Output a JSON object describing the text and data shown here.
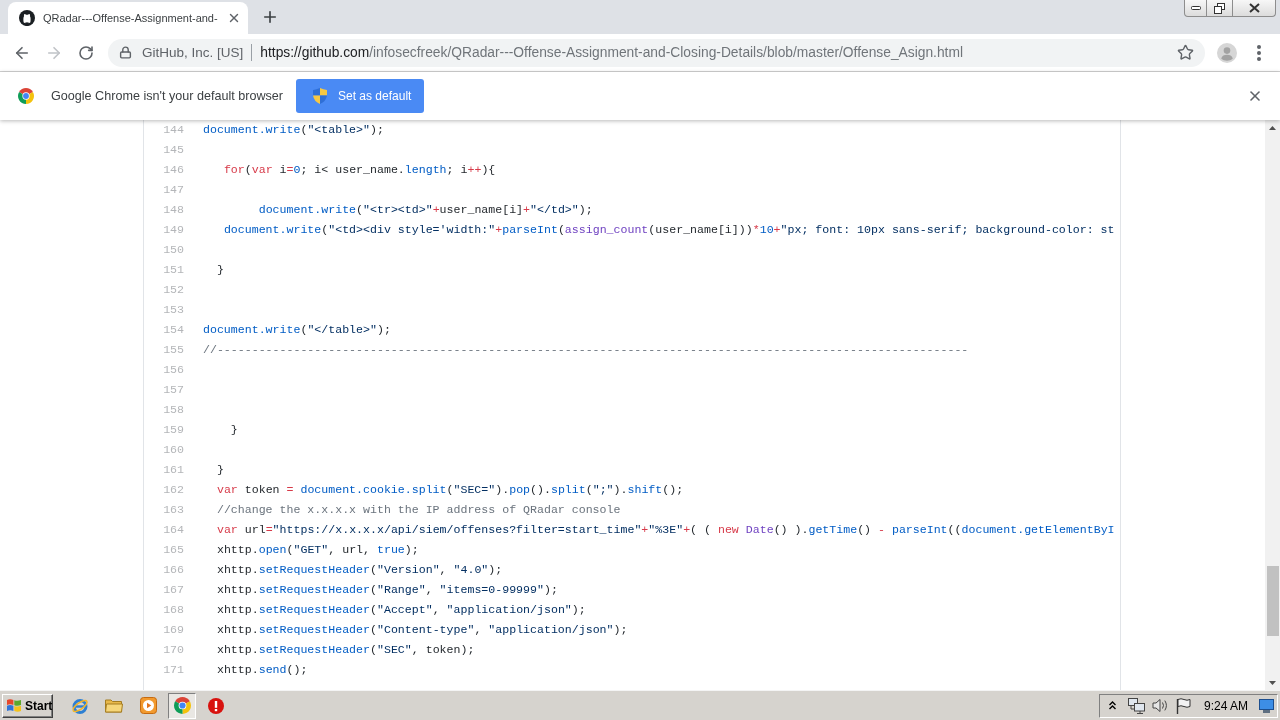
{
  "browser": {
    "tabs": [
      {
        "title": "QRadar---Offense-Assignment-and-",
        "selected": true
      }
    ],
    "navigation": [
      {
        "kind": "back",
        "disabled": false
      },
      {
        "kind": "forward",
        "disabled": true
      },
      {
        "kind": "reload",
        "disabled": false
      }
    ],
    "address_bar": {
      "site_identity": "GitHub, Inc. [US]",
      "url_origin": "https://github.com",
      "url_path": "/infosecfreek/QRadar---Offense-Assignment-and-Closing-Details/blob/master/Offense_Asign.html",
      "bookmarked": false
    }
  },
  "infobar": {
    "message": "Google Chrome isn't your default browser",
    "button": "Set as default"
  },
  "code": {
    "lines": [
      {
        "number": "144",
        "tokens": [
          {
            "kind": "builtin",
            "text": "document.write"
          },
          {
            "kind": "text",
            "text": "("
          },
          {
            "kind": "string",
            "text": "\"<table>\""
          },
          {
            "kind": "text",
            "text": ");"
          }
        ]
      },
      {
        "number": "145"
      },
      {
        "number": "146",
        "tokens": [
          {
            "kind": "keyword",
            "text": "   for"
          },
          {
            "kind": "text",
            "text": "("
          },
          {
            "kind": "keyword",
            "text": "var"
          },
          {
            "kind": "text",
            "text": " i"
          },
          {
            "kind": "keyword",
            "text": "="
          },
          {
            "kind": "builtin",
            "text": "0"
          },
          {
            "kind": "text",
            "text": "; i< user_name."
          },
          {
            "kind": "builtin",
            "text": "length"
          },
          {
            "kind": "text",
            "text": "; i"
          },
          {
            "kind": "keyword",
            "text": "++"
          },
          {
            "kind": "text",
            "text": "){"
          }
        ]
      },
      {
        "number": "147"
      },
      {
        "number": "148",
        "tokens": [
          {
            "kind": "builtin",
            "text": "        document.write"
          },
          {
            "kind": "text",
            "text": "("
          },
          {
            "kind": "string",
            "text": "\"<tr><td>\""
          },
          {
            "kind": "keyword",
            "text": "+"
          },
          {
            "kind": "text",
            "text": "user_name[i]"
          },
          {
            "kind": "keyword",
            "text": "+"
          },
          {
            "kind": "string",
            "text": "\"</td>\""
          },
          {
            "kind": "text",
            "text": ");"
          }
        ]
      },
      {
        "number": "149",
        "tokens": [
          {
            "kind": "builtin",
            "text": "   document.write"
          },
          {
            "kind": "text",
            "text": "("
          },
          {
            "kind": "string",
            "text": "\"<td><div style='width:\""
          },
          {
            "kind": "keyword",
            "text": "+"
          },
          {
            "kind": "builtin",
            "text": "parseInt"
          },
          {
            "kind": "text",
            "text": "("
          },
          {
            "kind": "function",
            "text": "assign_count"
          },
          {
            "kind": "text",
            "text": "(user_name[i]))"
          },
          {
            "kind": "keyword",
            "text": "*"
          },
          {
            "kind": "builtin",
            "text": "10"
          },
          {
            "kind": "keyword",
            "text": "+"
          },
          {
            "kind": "string",
            "text": "\"px; font: 10px sans-serif; background-color: st"
          }
        ]
      },
      {
        "number": "150"
      },
      {
        "number": "151",
        "tokens": [
          {
            "kind": "text",
            "text": "  }"
          }
        ]
      },
      {
        "number": "152"
      },
      {
        "number": "153"
      },
      {
        "number": "154",
        "tokens": [
          {
            "kind": "builtin",
            "text": "document.write"
          },
          {
            "kind": "text",
            "text": "("
          },
          {
            "kind": "string",
            "text": "\"</table>\""
          },
          {
            "kind": "text",
            "text": ");"
          }
        ]
      },
      {
        "number": "155",
        "tokens": [
          {
            "kind": "comment",
            "text": "//------------------------------------------------------------------------------------------------------------"
          }
        ]
      },
      {
        "number": "156"
      },
      {
        "number": "157"
      },
      {
        "number": "158"
      },
      {
        "number": "159",
        "tokens": [
          {
            "kind": "text",
            "text": "    }"
          }
        ]
      },
      {
        "number": "160"
      },
      {
        "number": "161",
        "tokens": [
          {
            "kind": "text",
            "text": "  }"
          }
        ]
      },
      {
        "number": "162",
        "tokens": [
          {
            "kind": "keyword",
            "text": "  var"
          },
          {
            "kind": "text",
            "text": " token "
          },
          {
            "kind": "keyword",
            "text": "= "
          },
          {
            "kind": "builtin",
            "text": "document.cookie.split"
          },
          {
            "kind": "text",
            "text": "("
          },
          {
            "kind": "string",
            "text": "\"SEC=\""
          },
          {
            "kind": "text",
            "text": ")."
          },
          {
            "kind": "builtin",
            "text": "pop"
          },
          {
            "kind": "text",
            "text": "()."
          },
          {
            "kind": "builtin",
            "text": "split"
          },
          {
            "kind": "text",
            "text": "("
          },
          {
            "kind": "string",
            "text": "\";\""
          },
          {
            "kind": "text",
            "text": ")."
          },
          {
            "kind": "builtin",
            "text": "shift"
          },
          {
            "kind": "text",
            "text": "();"
          }
        ]
      },
      {
        "number": "163",
        "tokens": [
          {
            "kind": "comment",
            "text": "  //change the x.x.x.x with the IP address of QRadar console"
          }
        ]
      },
      {
        "number": "164",
        "tokens": [
          {
            "kind": "keyword",
            "text": "  var"
          },
          {
            "kind": "text",
            "text": " url"
          },
          {
            "kind": "keyword",
            "text": "="
          },
          {
            "kind": "string",
            "text": "\"https://x.x.x.x/api/siem/offenses?filter=start_time\""
          },
          {
            "kind": "keyword",
            "text": "+"
          },
          {
            "kind": "string",
            "text": "\"%3E\""
          },
          {
            "kind": "keyword",
            "text": "+"
          },
          {
            "kind": "text",
            "text": "( ( "
          },
          {
            "kind": "keyword",
            "text": "new "
          },
          {
            "kind": "function",
            "text": "Date"
          },
          {
            "kind": "text",
            "text": "() )."
          },
          {
            "kind": "builtin",
            "text": "getTime"
          },
          {
            "kind": "text",
            "text": "() "
          },
          {
            "kind": "keyword",
            "text": "- "
          },
          {
            "kind": "builtin",
            "text": "parseInt"
          },
          {
            "kind": "text",
            "text": "(("
          },
          {
            "kind": "builtin",
            "text": "document.getElementByI"
          }
        ]
      },
      {
        "number": "165",
        "tokens": [
          {
            "kind": "text",
            "text": "  xhttp."
          },
          {
            "kind": "builtin",
            "text": "open"
          },
          {
            "kind": "text",
            "text": "("
          },
          {
            "kind": "string",
            "text": "\"GET\""
          },
          {
            "kind": "text",
            "text": ", url, "
          },
          {
            "kind": "builtin",
            "text": "true"
          },
          {
            "kind": "text",
            "text": ");"
          }
        ]
      },
      {
        "number": "166",
        "tokens": [
          {
            "kind": "text",
            "text": "  xhttp."
          },
          {
            "kind": "builtin",
            "text": "setRequestHeader"
          },
          {
            "kind": "text",
            "text": "("
          },
          {
            "kind": "string",
            "text": "\"Version\""
          },
          {
            "kind": "text",
            "text": ", "
          },
          {
            "kind": "string",
            "text": "\"4.0\""
          },
          {
            "kind": "text",
            "text": ");"
          }
        ]
      },
      {
        "number": "167",
        "tokens": [
          {
            "kind": "text",
            "text": "  xhttp."
          },
          {
            "kind": "builtin",
            "text": "setRequestHeader"
          },
          {
            "kind": "text",
            "text": "("
          },
          {
            "kind": "string",
            "text": "\"Range\""
          },
          {
            "kind": "text",
            "text": ", "
          },
          {
            "kind": "string",
            "text": "\"items=0-99999\""
          },
          {
            "kind": "text",
            "text": ");"
          }
        ]
      },
      {
        "number": "168",
        "tokens": [
          {
            "kind": "text",
            "text": "  xhttp."
          },
          {
            "kind": "builtin",
            "text": "setRequestHeader"
          },
          {
            "kind": "text",
            "text": "("
          },
          {
            "kind": "string",
            "text": "\"Accept\""
          },
          {
            "kind": "text",
            "text": ", "
          },
          {
            "kind": "string",
            "text": "\"application/json\""
          },
          {
            "kind": "text",
            "text": ");"
          }
        ]
      },
      {
        "number": "169",
        "tokens": [
          {
            "kind": "text",
            "text": "  xhttp."
          },
          {
            "kind": "builtin",
            "text": "setRequestHeader"
          },
          {
            "kind": "text",
            "text": "("
          },
          {
            "kind": "string",
            "text": "\"Content-type\""
          },
          {
            "kind": "text",
            "text": ", "
          },
          {
            "kind": "string",
            "text": "\"application/json\""
          },
          {
            "kind": "text",
            "text": ");"
          }
        ]
      },
      {
        "number": "170",
        "tokens": [
          {
            "kind": "text",
            "text": "  xhttp."
          },
          {
            "kind": "builtin",
            "text": "setRequestHeader"
          },
          {
            "kind": "text",
            "text": "("
          },
          {
            "kind": "string",
            "text": "\"SEC\""
          },
          {
            "kind": "text",
            "text": ", token);"
          }
        ]
      },
      {
        "number": "171",
        "tokens": [
          {
            "kind": "text",
            "text": "  xhttp."
          },
          {
            "kind": "builtin",
            "text": "send"
          },
          {
            "kind": "text",
            "text": "();"
          }
        ]
      }
    ]
  },
  "taskbar": {
    "start_label": "Start",
    "apps": [
      {
        "kind": "globe",
        "selected": false
      },
      {
        "kind": "folder",
        "selected": false
      },
      {
        "kind": "player",
        "selected": false
      },
      {
        "kind": "chrome",
        "selected": true
      },
      {
        "kind": "alert",
        "selected": false
      }
    ],
    "clock": "9:24 AM"
  }
}
